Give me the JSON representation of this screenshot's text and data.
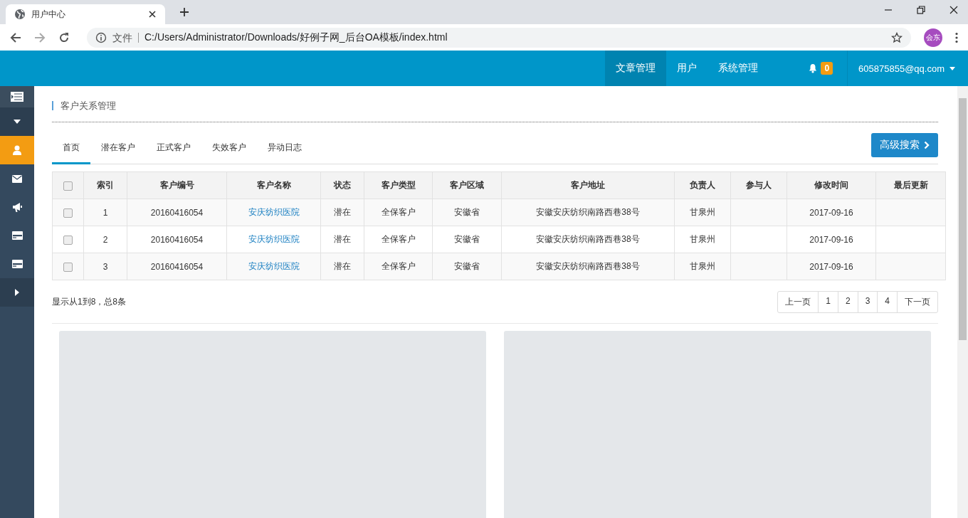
{
  "browser": {
    "tab_title": "用户中心",
    "address_prefix": "文件",
    "url": "C:/Users/Administrator/Downloads/好例子网_后台OA模板/index.html",
    "profile": "会东"
  },
  "nav": {
    "items": [
      {
        "label": "文章管理",
        "selected": true
      },
      {
        "label": "用户",
        "selected": false
      },
      {
        "label": "系统管理",
        "selected": false
      }
    ],
    "notification_count": "0",
    "user": "605875855@qq.com"
  },
  "sidebar": {
    "items": [
      {
        "kind": "menu",
        "selected": false
      },
      {
        "kind": "caret-down",
        "selected": false
      },
      {
        "kind": "user",
        "selected": true
      },
      {
        "kind": "mail",
        "selected": false
      },
      {
        "kind": "megaphone",
        "selected": false
      },
      {
        "kind": "card",
        "selected": false
      },
      {
        "kind": "card",
        "selected": false
      },
      {
        "kind": "caret-right",
        "selected": false
      }
    ]
  },
  "breadcrumb": "客户关系管理",
  "tabs": [
    {
      "label": "首页",
      "selected": true
    },
    {
      "label": "潜在客户",
      "selected": false
    },
    {
      "label": "正式客户",
      "selected": false
    },
    {
      "label": "失效客户",
      "selected": false
    },
    {
      "label": "异动日志",
      "selected": false
    }
  ],
  "advanced_search_button": "高级搜索",
  "table": {
    "select_all_checked": false,
    "columns": [
      {
        "label": "索引",
        "kind": "text"
      },
      {
        "label": "客户编号",
        "kind": "text"
      },
      {
        "label": "客户名称",
        "kind": "link"
      },
      {
        "label": "状态",
        "kind": "text"
      },
      {
        "label": "客户类型",
        "kind": "text"
      },
      {
        "label": "客户区域",
        "kind": "text"
      },
      {
        "label": "客户地址",
        "kind": "text"
      },
      {
        "label": "负责人",
        "kind": "text"
      },
      {
        "label": "参与人",
        "kind": "text"
      },
      {
        "label": "修改时间",
        "kind": "text"
      },
      {
        "label": "最后更新",
        "kind": "text"
      }
    ],
    "rows": [
      {
        "checked": false,
        "cells": [
          "1",
          "20160416054",
          "安庆纺织医院",
          "潜在",
          "全保客户",
          "安徽省",
          "安徽安庆纺织南路西巷38号",
          "甘泉州",
          "",
          "2017-09-16",
          ""
        ]
      },
      {
        "checked": false,
        "cells": [
          "2",
          "20160416054",
          "安庆纺织医院",
          "潜在",
          "全保客户",
          "安徽省",
          "安徽安庆纺织南路西巷38号",
          "甘泉州",
          "",
          "2017-09-16",
          ""
        ]
      },
      {
        "checked": false,
        "cells": [
          "3",
          "20160416054",
          "安庆纺织医院",
          "潜在",
          "全保客户",
          "安徽省",
          "安徽安庆纺织南路西巷38号",
          "甘泉州",
          "",
          "2017-09-16",
          ""
        ]
      }
    ]
  },
  "pagination": {
    "summary": "显示从1到8，总8条",
    "pages": [
      "上一页",
      "1",
      "2",
      "3",
      "4",
      "下一页"
    ]
  }
}
